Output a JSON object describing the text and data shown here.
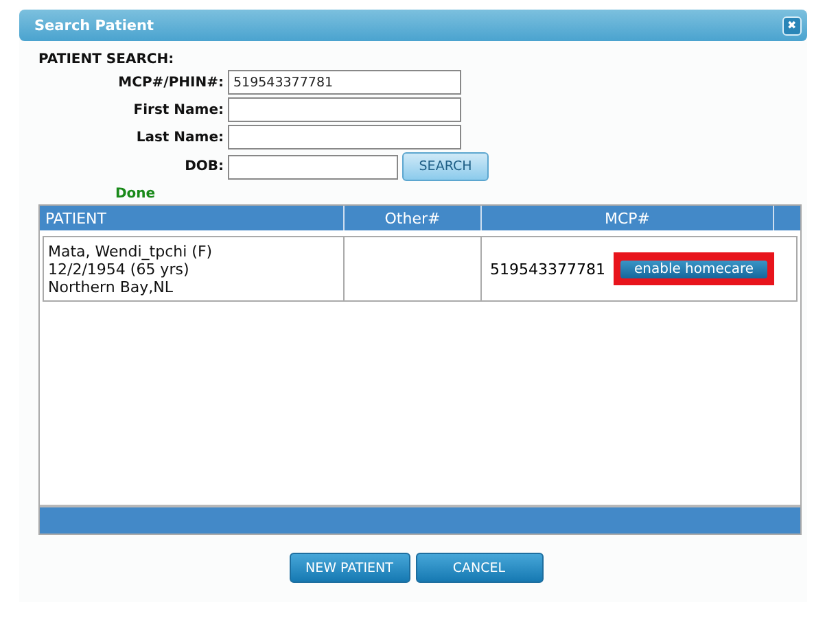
{
  "window": {
    "title": "Search Patient",
    "close": "✖"
  },
  "search": {
    "heading": "PATIENT SEARCH:",
    "fields": [
      {
        "label": "MCP#/PHIN#:",
        "value": "519543377781"
      },
      {
        "label": "First Name:"
      },
      {
        "label": "Last Name:"
      },
      {
        "label": "DOB:"
      }
    ],
    "button": "SEARCH",
    "status": "Done"
  },
  "table": {
    "columns": [
      "PATIENT",
      "Other#",
      "MCP#"
    ],
    "rows": [
      {
        "patient": [
          "Mata, Wendi_tpchi (F)",
          "12/2/1954 (65 yrs)",
          "Northern Bay,NL"
        ],
        "mcp": "519543377781",
        "action": "enable homecare",
        "highlighted": true
      }
    ]
  },
  "buttons": [
    "NEW PATIENT",
    "CANCEL"
  ]
}
